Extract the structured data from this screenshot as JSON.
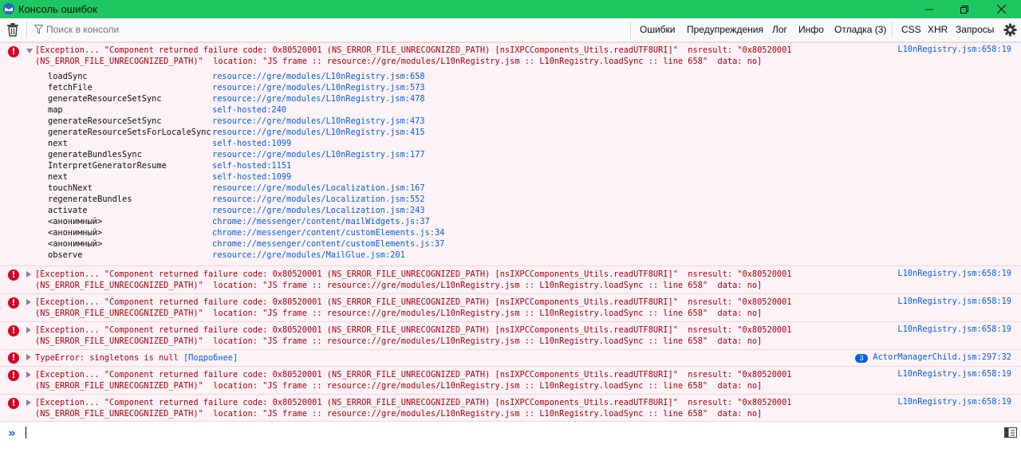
{
  "window": {
    "title": "Консоль ошибок"
  },
  "toolbar": {
    "filter_placeholder": "Поиск в консоли",
    "filters": [
      {
        "label": "Ошибки",
        "active": true
      },
      {
        "label": "Предупреждения",
        "active": true
      },
      {
        "label": "Лог",
        "active": true
      },
      {
        "label": "Инфо",
        "active": true
      },
      {
        "label": "Отладка (3)",
        "active": false
      }
    ],
    "extra_filters": [
      "CSS",
      "XHR",
      "Запросы"
    ]
  },
  "messages": [
    {
      "text": "[Exception... \"Component returned failure code: 0x80520001 (NS_ERROR_FILE_UNRECOGNIZED_PATH) [nsIXPCComponents_Utils.readUTF8URI]\"  nsresult: \"0x80520001\n(NS_ERROR_FILE_UNRECOGNIZED_PATH)\"  location: \"JS frame :: resource://gre/modules/L10nRegistry.jsm :: L10nRegistry.loadSync :: line 658\"  data: no]",
      "location": "L10nRegistry.jsm:658:19",
      "expanded": true,
      "stack": [
        {
          "fn": "loadSync",
          "loc": "resource://gre/modules/L10nRegistry.jsm:658"
        },
        {
          "fn": "fetchFile",
          "loc": "resource://gre/modules/L10nRegistry.jsm:573"
        },
        {
          "fn": "generateResourceSetSync",
          "loc": "resource://gre/modules/L10nRegistry.jsm:478"
        },
        {
          "fn": "map",
          "loc": "self-hosted:240"
        },
        {
          "fn": "generateResourceSetSync",
          "loc": "resource://gre/modules/L10nRegistry.jsm:473"
        },
        {
          "fn": "generateResourceSetsForLocaleSync",
          "loc": "resource://gre/modules/L10nRegistry.jsm:415"
        },
        {
          "fn": "next",
          "loc": "self-hosted:1099"
        },
        {
          "fn": "generateBundlesSync",
          "loc": "resource://gre/modules/L10nRegistry.jsm:177"
        },
        {
          "fn": "InterpretGeneratorResume",
          "loc": "self-hosted:1151"
        },
        {
          "fn": "next",
          "loc": "self-hosted:1099"
        },
        {
          "fn": "touchNext",
          "loc": "resource://gre/modules/Localization.jsm:167"
        },
        {
          "fn": "regenerateBundles",
          "loc": "resource://gre/modules/Localization.jsm:552"
        },
        {
          "fn": "activate",
          "loc": "resource://gre/modules/Localization.jsm:243"
        },
        {
          "fn": "<анонимный>",
          "loc": "chrome://messenger/content/mailWidgets.js:37"
        },
        {
          "fn": "<анонимный>",
          "loc": "chrome://messenger/content/customElements.js:34"
        },
        {
          "fn": "<анонимный>",
          "loc": "chrome://messenger/content/customElements.js:37"
        },
        {
          "fn": "observe",
          "loc": "resource://gre/modules/MailGlue.jsm:201"
        }
      ]
    },
    {
      "text": "[Exception... \"Component returned failure code: 0x80520001 (NS_ERROR_FILE_UNRECOGNIZED_PATH) [nsIXPCComponents_Utils.readUTF8URI]\"  nsresult: \"0x80520001\n(NS_ERROR_FILE_UNRECOGNIZED_PATH)\"  location: \"JS frame :: resource://gre/modules/L10nRegistry.jsm :: L10nRegistry.loadSync :: line 658\"  data: no]",
      "location": "L10nRegistry.jsm:658:19"
    },
    {
      "text": "[Exception... \"Component returned failure code: 0x80520001 (NS_ERROR_FILE_UNRECOGNIZED_PATH) [nsIXPCComponents_Utils.readUTF8URI]\"  nsresult: \"0x80520001\n(NS_ERROR_FILE_UNRECOGNIZED_PATH)\"  location: \"JS frame :: resource://gre/modules/L10nRegistry.jsm :: L10nRegistry.loadSync :: line 658\"  data: no]",
      "location": "L10nRegistry.jsm:658:19"
    },
    {
      "text": "[Exception... \"Component returned failure code: 0x80520001 (NS_ERROR_FILE_UNRECOGNIZED_PATH) [nsIXPCComponents_Utils.readUTF8URI]\"  nsresult: \"0x80520001\n(NS_ERROR_FILE_UNRECOGNIZED_PATH)\"  location: \"JS frame :: resource://gre/modules/L10nRegistry.jsm :: L10nRegistry.loadSync :: line 658\"  data: no]",
      "location": "L10nRegistry.jsm:658:19"
    },
    {
      "text": "TypeError: singletons is null",
      "more_label": "[Подробнее]",
      "repeat": "3",
      "location": "ActorManagerChild.jsm:297:32"
    },
    {
      "text": "[Exception... \"Component returned failure code: 0x80520001 (NS_ERROR_FILE_UNRECOGNIZED_PATH) [nsIXPCComponents_Utils.readUTF8URI]\"  nsresult: \"0x80520001\n(NS_ERROR_FILE_UNRECOGNIZED_PATH)\"  location: \"JS frame :: resource://gre/modules/L10nRegistry.jsm :: L10nRegistry.loadSync :: line 658\"  data: no]",
      "location": "L10nRegistry.jsm:658:19"
    },
    {
      "text": "[Exception... \"Component returned failure code: 0x80520001 (NS_ERROR_FILE_UNRECOGNIZED_PATH) [nsIXPCComponents_Utils.readUTF8URI]\"  nsresult: \"0x80520001\n(NS_ERROR_FILE_UNRECOGNIZED_PATH)\"  location: \"JS frame :: resource://gre/modules/L10nRegistry.jsm :: L10nRegistry.loadSync :: line 658\"  data: no]",
      "location": "L10nRegistry.jsm:658:19"
    }
  ],
  "colors": {
    "titlebar": "#1ec760",
    "error": "#a4000f",
    "link": "#0060df",
    "error_bg": "#fdf2f5"
  },
  "icons": [
    "app-icon",
    "minimize-icon",
    "maximize-icon",
    "close-icon",
    "trash-icon",
    "filter-icon",
    "gear-icon",
    "error-icon",
    "prompt-icon",
    "split-editor-icon"
  ]
}
